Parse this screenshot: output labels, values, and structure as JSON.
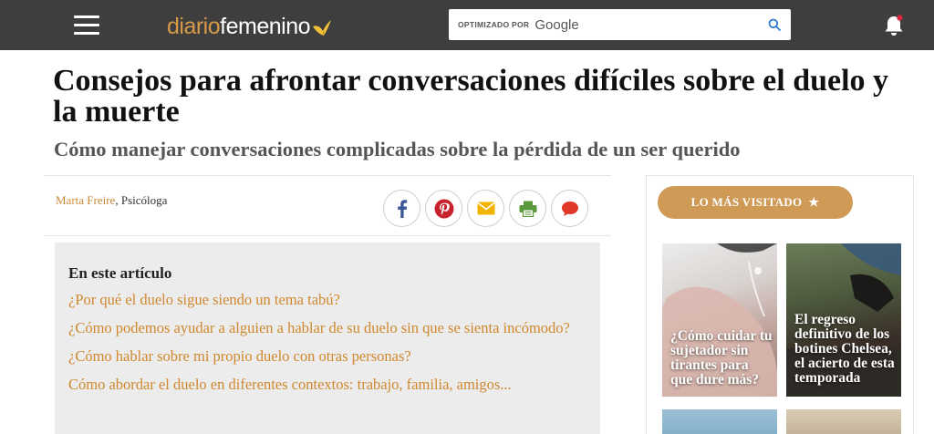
{
  "header": {
    "logo_part1": "diario",
    "logo_part2": "femenino",
    "search": {
      "optimized_by": "OPTIMIZADO POR",
      "provider": "Google",
      "placeholder": ""
    }
  },
  "article": {
    "title": "Consejos para afrontar conversaciones difíciles sobre el duelo y la muerte",
    "subtitle": "Cómo manejar conversaciones complicadas sobre la pérdida de un ser querido",
    "author": "Marta Freire",
    "author_role": ", Psicóloga"
  },
  "share": {
    "icons": [
      "facebook-icon",
      "pinterest-icon",
      "email-icon",
      "print-icon",
      "comment-icon"
    ]
  },
  "toc": {
    "title": "En este artículo",
    "items": [
      "¿Por qué el duelo sigue siendo un tema tabú?",
      "¿Cómo podemos ayudar a alguien a hablar de su duelo sin que se sienta incómodo?",
      "¿Cómo hablar sobre mi propio duelo con otras personas?",
      "Cómo abordar el duelo en diferentes contextos: trabajo, familia, amigos..."
    ]
  },
  "sidebar": {
    "most_visited_label": "LO MÁS VISITADO",
    "cards": [
      {
        "title": "¿Cómo cuidar tu sujetador sin tirantes para que dure más?"
      },
      {
        "title": "El regreso definitivo de los botines Chelsea, el acierto de esta temporada"
      }
    ]
  },
  "colors": {
    "header_bg": "#3e3e3e",
    "accent": "#cf9a55",
    "link": "#d0882f"
  }
}
